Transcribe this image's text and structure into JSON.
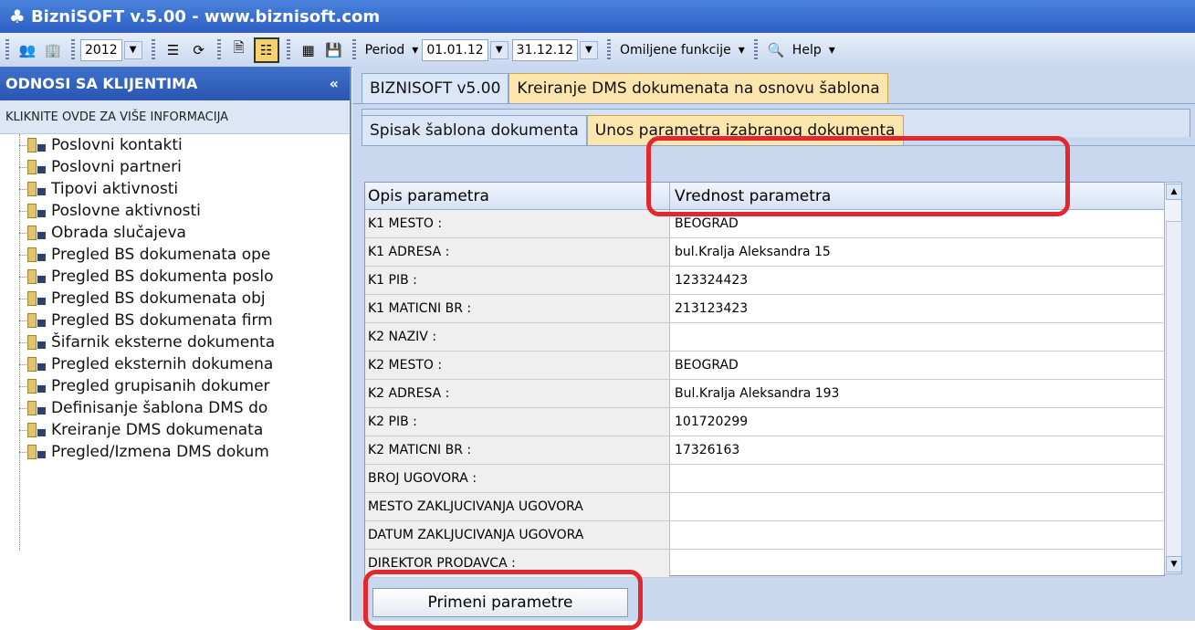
{
  "title": "BizniSOFT v.5.00 - www.biznisoft.com",
  "toolbar": {
    "year": "2012",
    "period_label": "Period",
    "date_from": "01.01.12",
    "date_to": "31.12.12",
    "favorites": "Omiljene funkcije",
    "help": "Help"
  },
  "sidebar": {
    "header": "ODNOSI SA KLIJENTIMA",
    "collapse": "«",
    "info": "KLIKNITE OVDE ZA VIŠE INFORMACIJA",
    "items": [
      "Poslovni kontakti",
      "Poslovni partneri",
      "Tipovi aktivnosti",
      "Poslovne aktivnosti",
      "Obrada slučajeva",
      "Pregled BS dokumenata ope",
      "Pregled BS dokumenta poslo",
      "Pregled BS dokumenata obj",
      "Pregled BS dokumenata firm",
      "Šifarnik eksterne dokumenta",
      "Pregled eksternih dokumena",
      "Pregled grupisanih dokumer",
      "Definisanje šablona DMS do",
      "Kreiranje DMS dokumenata",
      "Pregled/Izmena DMS dokum"
    ]
  },
  "main": {
    "tab_home": "BIZNISOFT v5.00",
    "tab_active": "Kreiranje DMS dokumenata na osnovu šablona",
    "subtab1": "Spisak šablona dokumenta",
    "subtab2": "Unos parametra izabranog dokumenta",
    "col1": "Opis parametra",
    "col2": "Vrednost parametra",
    "rows": [
      {
        "label": "K1 MESTO :",
        "value": "BEOGRAD"
      },
      {
        "label": "K1 ADRESA :",
        "value": "bul.Kralja Aleksandra 15"
      },
      {
        "label": "K1 PIB :",
        "value": "123324423"
      },
      {
        "label": "K1 MATICNI BR :",
        "value": "213123423"
      },
      {
        "label": "K2 NAZIV :",
        "value": ""
      },
      {
        "label": "K2 MESTO :",
        "value": "BEOGRAD"
      },
      {
        "label": "K2 ADRESA :",
        "value": "Bul.Kralja Aleksandra 193"
      },
      {
        "label": "K2 PIB :",
        "value": "101720299"
      },
      {
        "label": "K2 MATICNI BR :",
        "value": "17326163"
      },
      {
        "label": "BROJ UGOVORA :",
        "value": ""
      },
      {
        "label": "MESTO ZAKLJUCIVANJA UGOVORA",
        "value": ""
      },
      {
        "label": "DATUM ZAKLJUCIVANJA UGOVORA",
        "value": ""
      },
      {
        "label": "DIREKTOR PRODAVCA :",
        "value": ""
      }
    ],
    "apply_button": "Primeni parametre"
  },
  "colors": {
    "accent_blue": "#2e5fc4",
    "active_tab": "#fde5ae",
    "highlight_red": "#e2282e"
  }
}
